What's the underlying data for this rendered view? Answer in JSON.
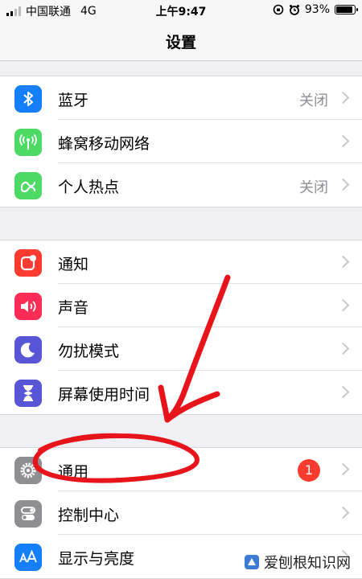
{
  "status_bar": {
    "carrier": "中国联通",
    "network": "4G",
    "time": "上午9:47",
    "battery_percent": "93%",
    "battery_level": 0.93
  },
  "nav": {
    "title": "设置"
  },
  "sections": [
    {
      "rows": [
        {
          "label": "蓝牙",
          "value": "关闭",
          "icon": "bluetooth-icon",
          "color": "#147efb"
        },
        {
          "label": "蜂窝移动网络",
          "value": "",
          "icon": "antenna-icon",
          "color": "#4cd964"
        },
        {
          "label": "个人热点",
          "value": "关闭",
          "icon": "hotspot-icon",
          "color": "#4cd964"
        }
      ]
    },
    {
      "rows": [
        {
          "label": "通知",
          "icon": "notification-icon",
          "color": "#ff3b30"
        },
        {
          "label": "声音",
          "icon": "speaker-icon",
          "color": "#ff2d55"
        },
        {
          "label": "勿扰模式",
          "icon": "moon-icon",
          "color": "#5856d6"
        },
        {
          "label": "屏幕使用时间",
          "icon": "hourglass-icon",
          "color": "#5856d6"
        }
      ]
    },
    {
      "rows": [
        {
          "label": "通用",
          "badge": "1",
          "icon": "gear-icon",
          "color": "#8e8e93"
        },
        {
          "label": "控制中心",
          "icon": "toggles-icon",
          "color": "#8e8e93"
        },
        {
          "label": "显示与亮度",
          "icon": "text-size-icon",
          "color": "#147efb"
        }
      ]
    }
  ],
  "watermark": {
    "text": "爱刨根知识网"
  }
}
